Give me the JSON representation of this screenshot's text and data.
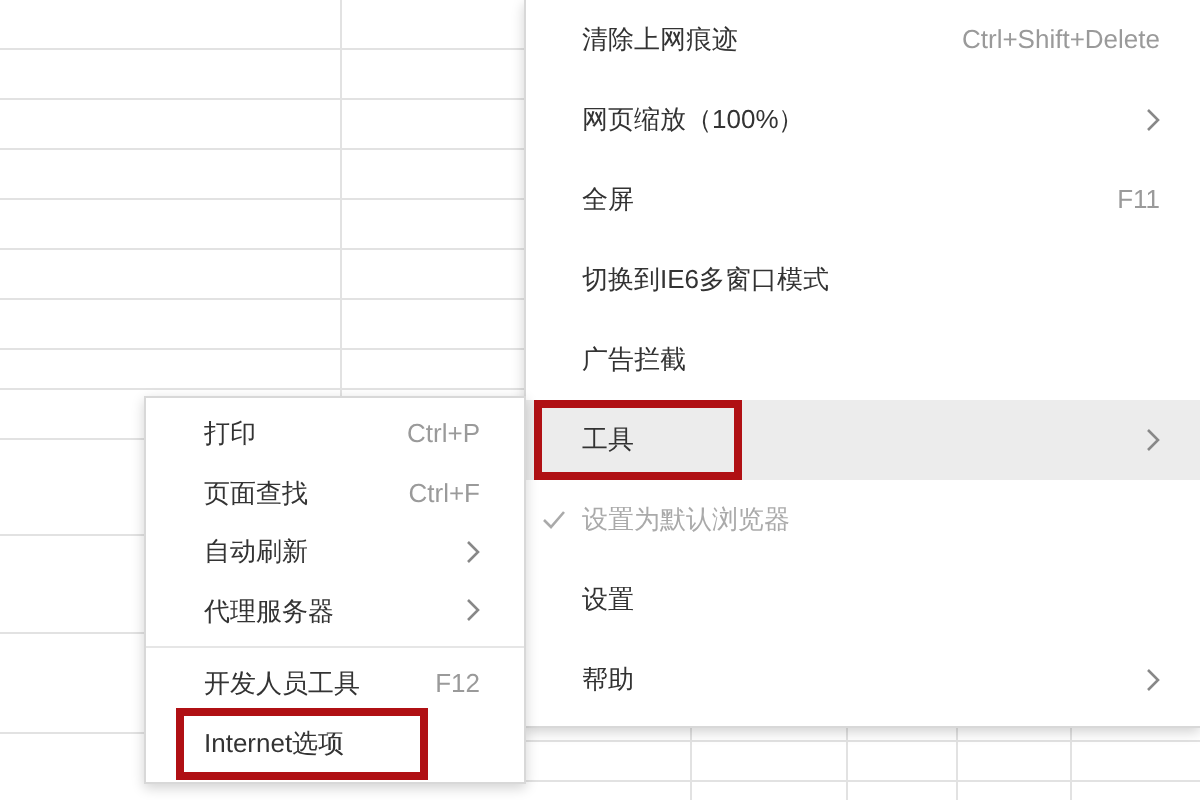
{
  "main_menu": {
    "items": [
      {
        "label": "清除上网痕迹",
        "shortcut": "Ctrl+Shift+Delete",
        "has_submenu": false,
        "selected": false,
        "disabled": false,
        "checked": false,
        "annotated": false
      },
      {
        "label": "网页缩放（100%）",
        "has_submenu": true,
        "selected": false,
        "disabled": false,
        "checked": false,
        "annotated": false
      },
      {
        "label": "全屏",
        "shortcut": "F11",
        "has_submenu": false,
        "selected": false,
        "disabled": false,
        "checked": false,
        "annotated": false
      },
      {
        "label": "切换到IE6多窗口模式",
        "has_submenu": false,
        "selected": false,
        "disabled": false,
        "checked": false,
        "annotated": false
      },
      {
        "label": "广告拦截",
        "has_submenu": false,
        "selected": false,
        "disabled": false,
        "checked": false,
        "annotated": false
      },
      {
        "label": "工具",
        "has_submenu": true,
        "selected": true,
        "disabled": false,
        "checked": false,
        "annotated": true
      },
      {
        "label": "设置为默认浏览器",
        "has_submenu": false,
        "selected": false,
        "disabled": true,
        "checked": true,
        "annotated": false
      },
      {
        "label": "设置",
        "has_submenu": false,
        "selected": false,
        "disabled": false,
        "checked": false,
        "annotated": false
      },
      {
        "label": "帮助",
        "has_submenu": true,
        "selected": false,
        "disabled": false,
        "checked": false,
        "annotated": false
      }
    ]
  },
  "tools_submenu": {
    "groups": [
      [
        {
          "label": "打印",
          "shortcut": "Ctrl+P",
          "has_submenu": false,
          "annotated": false
        },
        {
          "label": "页面查找",
          "shortcut": "Ctrl+F",
          "has_submenu": false,
          "annotated": false
        },
        {
          "label": "自动刷新",
          "has_submenu": true,
          "annotated": false
        },
        {
          "label": "代理服务器",
          "has_submenu": true,
          "annotated": false
        }
      ],
      [
        {
          "label": "开发人员工具",
          "shortcut": "F12",
          "has_submenu": false,
          "annotated": false
        },
        {
          "label": "Internet选项",
          "has_submenu": false,
          "annotated": true
        }
      ]
    ]
  }
}
